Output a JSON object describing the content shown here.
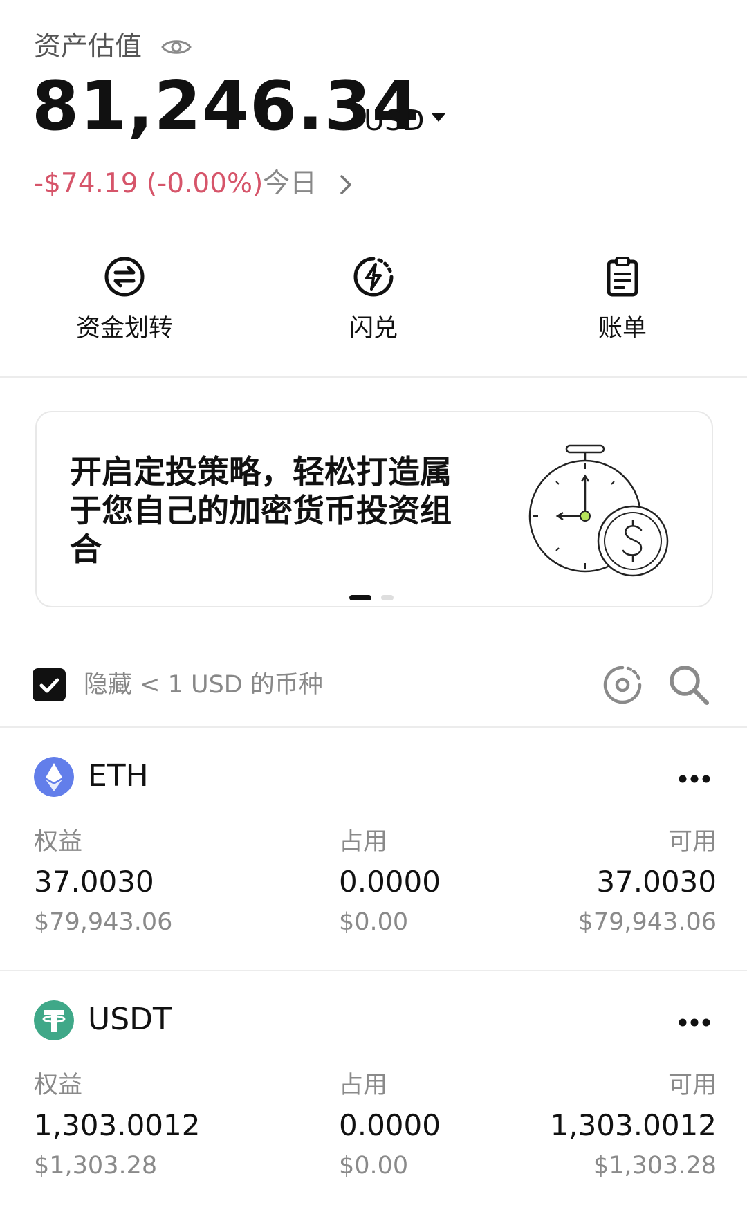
{
  "header": {
    "title": "资产估值",
    "total": "81,246.34",
    "currency": "USD",
    "change": "-$74.19 (-0.00%)",
    "period": "今日",
    "colors": {
      "negative": "#d6556a"
    }
  },
  "actions": [
    {
      "label": "资金划转",
      "icon": "transfer-icon"
    },
    {
      "label": "闪兑",
      "icon": "flash-swap-icon"
    },
    {
      "label": "账单",
      "icon": "bill-icon"
    }
  ],
  "banner": {
    "text": "开启定投策略，轻松打造属于您自己的加密货币投资组合",
    "icon": "stopwatch-coin-illustration"
  },
  "filter": {
    "checked": true,
    "label": "隐藏 < 1 USD 的币种"
  },
  "assets": [
    {
      "name": "ETH",
      "icon": "eth-icon",
      "color": "#627eea",
      "equity_label": "权益",
      "equity": "37.0030",
      "equity_usd": "$79,943.06",
      "used_label": "占用",
      "used": "0.0000",
      "used_usd": "$0.00",
      "available_label": "可用",
      "available": "37.0030",
      "available_usd": "$79,943.06"
    },
    {
      "name": "USDT",
      "icon": "usdt-icon",
      "color": "#3fa888",
      "equity_label": "权益",
      "equity": "1,303.0012",
      "equity_usd": "$1,303.28",
      "used_label": "占用",
      "used": "0.0000",
      "used_usd": "$0.00",
      "available_label": "可用",
      "available": "1,303.0012",
      "available_usd": "$1,303.28"
    }
  ]
}
